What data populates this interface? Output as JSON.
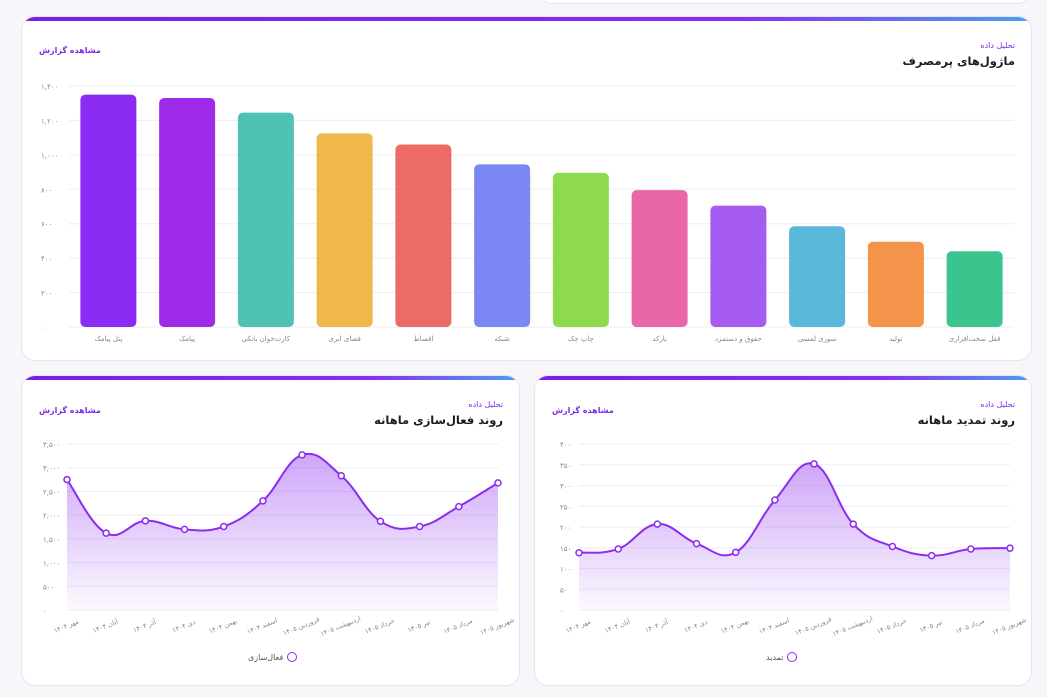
{
  "colors": {
    "accent": "#8b2cf0",
    "gridline": "#eeeef3",
    "text_muted": "#888"
  },
  "cards": {
    "modules": {
      "eyebrow": "تحلیل داده",
      "title": "ماژول‌های پرمصرف",
      "link": "مشاهده گزارش"
    },
    "activation": {
      "eyebrow": "تحلیل داده",
      "title": "روند فعال‌سازی ماهانه",
      "link": "مشاهده گزارش",
      "legend": "فعال‌سازی"
    },
    "renewal": {
      "eyebrow": "تحلیل داده",
      "title": "روند تمدید ماهانه",
      "link": "مشاهده گزارش",
      "legend": "تمدید"
    }
  },
  "chart_data": [
    {
      "id": "modules",
      "type": "bar",
      "categories": [
        "پنل پیامک",
        "پیامک",
        "کارت‌خوان بانکی",
        "فضای ابری",
        "اقساط",
        "شبکه",
        "چاپ چک",
        "بارکد",
        "حقوق و دستمزد",
        "سوری لمسی",
        "تولید",
        "قفل سخت‌افزاری"
      ],
      "values": [
        1350,
        1330,
        1245,
        1125,
        1060,
        945,
        895,
        795,
        705,
        585,
        495,
        440
      ],
      "colors": [
        "#8b2cf5",
        "#9d2be8",
        "#4fc2b4",
        "#f0b74d",
        "#ec6b66",
        "#7b87f2",
        "#8fd94d",
        "#ea67a7",
        "#a65cf0",
        "#5ab9db",
        "#f4934a",
        "#3ac58f"
      ],
      "ylim": [
        0,
        1400
      ],
      "yticks": [
        "۰",
        "۲۰۰",
        "۴۰۰",
        "۶۰۰",
        "۸۰۰",
        "۱,۰۰۰",
        "۱,۲۰۰",
        "۱,۴۰۰"
      ],
      "ytick_values": [
        0,
        200,
        400,
        600,
        800,
        1000,
        1200,
        1400
      ],
      "grid": true
    },
    {
      "id": "activation",
      "type": "area",
      "categories": [
        "مهر ۱۴۰۴",
        "آبان ۱۴۰۴",
        "آذر ۱۴۰۴",
        "دی ۱۴۰۴",
        "بهمن ۱۴۰۴",
        "اسفند ۱۴۰۴",
        "فروردین ۱۴۰۵",
        "اردیبهشت ۱۴۰۵",
        "خرداد ۱۴۰۵",
        "تیر ۱۴۰۵",
        "مرداد ۱۴۰۵",
        "شهریور ۱۴۰۵"
      ],
      "series": [
        {
          "name": "فعال‌سازی",
          "values": [
            2750,
            1620,
            1880,
            1700,
            1760,
            2300,
            3270,
            2830,
            1870,
            1760,
            2180,
            2680
          ]
        }
      ],
      "ylim": [
        0,
        3500
      ],
      "yticks": [
        "۰",
        "۵۰۰",
        "۱,۰۰۰",
        "۱,۵۰۰",
        "۲,۰۰۰",
        "۲,۵۰۰",
        "۳,۰۰۰",
        "۳,۵۰۰"
      ],
      "ytick_values": [
        0,
        500,
        1000,
        1500,
        2000,
        2500,
        3000,
        3500
      ],
      "grid": true,
      "legend": "bottom"
    },
    {
      "id": "renewal",
      "type": "area",
      "categories": [
        "مهر ۱۴۰۴",
        "آبان ۱۴۰۴",
        "آذر ۱۴۰۴",
        "دی ۱۴۰۴",
        "بهمن ۱۴۰۴",
        "اسفند ۱۴۰۴",
        "فروردین ۱۴۰۵",
        "اردیبهشت ۱۴۰۵",
        "خرداد ۱۴۰۵",
        "تیر ۱۴۰۵",
        "مرداد ۱۴۰۵",
        "شهریور ۱۴۰۵"
      ],
      "series": [
        {
          "name": "تمدید",
          "values": [
            138,
            147,
            207,
            160,
            139,
            265,
            352,
            207,
            153,
            131,
            147,
            149
          ]
        }
      ],
      "ylim": [
        0,
        400
      ],
      "yticks": [
        "۰",
        "۵۰",
        "۱۰۰",
        "۱۵۰",
        "۲۰۰",
        "۲۵۰",
        "۳۰۰",
        "۳۵۰",
        "۴۰۰"
      ],
      "ytick_values": [
        0,
        50,
        100,
        150,
        200,
        250,
        300,
        350,
        400
      ],
      "grid": true,
      "legend": "bottom"
    }
  ]
}
